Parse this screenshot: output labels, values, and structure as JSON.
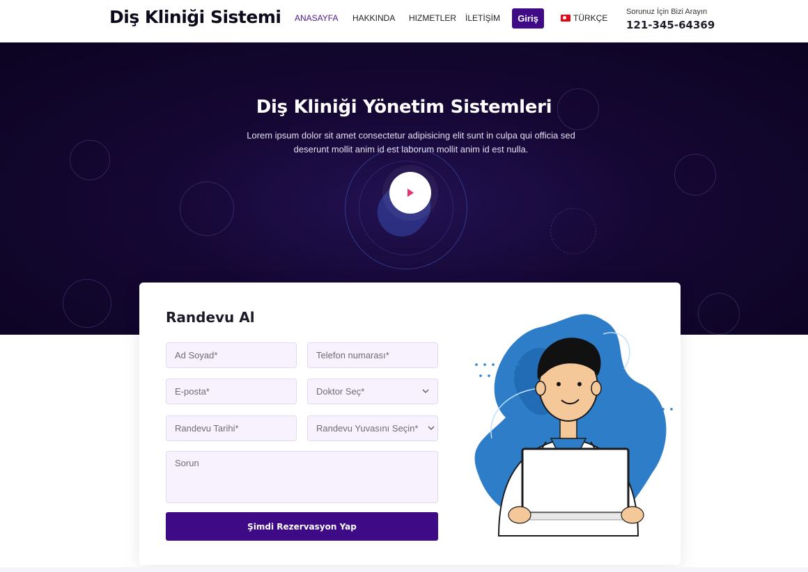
{
  "header": {
    "logo": "Diş Kliniği Sistemi",
    "nav": [
      "ANASAYFA",
      "HAKKINDA",
      "HIZMETLER",
      "İLETİŞİM"
    ],
    "login": "Giriş",
    "language": "TÜRKÇE",
    "phone_label": "Sorunuz İçin Bizi Arayın",
    "phone_number": "121-345-64369"
  },
  "hero": {
    "title": "Diş Kliniği Yönetim Sistemleri",
    "subtitle": "Lorem ipsum dolor sit amet consectetur adipisicing elit sunt in culpa qui officia sed deserunt mollit anim id est laborum mollit anim id est nulla.",
    "play_icon": "play-icon"
  },
  "form": {
    "title": "Randevu Al",
    "fields": {
      "name": "Ad Soyad*",
      "phone": "Telefon numarası*",
      "email": "E-posta*",
      "doctor": "Doktor Seç*",
      "date": "Randevu Tarihi*",
      "slot": "Randevu Yuvasını Seçin*",
      "problem": "Sorun"
    },
    "submit": "Şimdi Rezervasyon Yap"
  },
  "colors": {
    "primary": "#3e0a85",
    "nav_active": "#4a1a8c",
    "hero_bg": "#150733",
    "field_bg": "#f7f2fd",
    "play_accent": "#e8336d",
    "illustration_blue": "#2e7dc8"
  }
}
